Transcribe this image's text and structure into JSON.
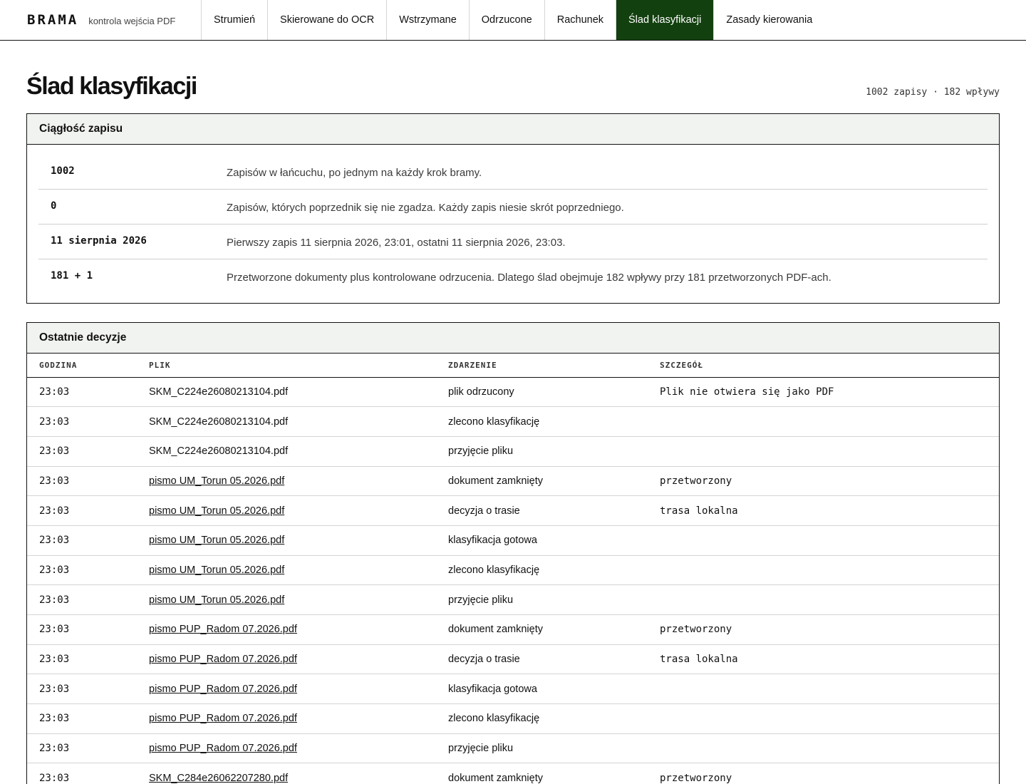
{
  "brand": {
    "logo": "BRAMA",
    "subtitle": "kontrola wejścia PDF"
  },
  "nav": [
    {
      "label": "Strumień",
      "active": false
    },
    {
      "label": "Skierowane do OCR",
      "active": false
    },
    {
      "label": "Wstrzymane",
      "active": false
    },
    {
      "label": "Odrzucone",
      "active": false
    },
    {
      "label": "Rachunek",
      "active": false
    },
    {
      "label": "Ślad klasyfikacji",
      "active": true
    },
    {
      "label": "Zasady kierowania",
      "active": false
    }
  ],
  "page": {
    "title": "Ślad klasyfikacji",
    "meta": "1002 zapisy · 182 wpływy"
  },
  "continuity": {
    "title": "Ciągłość zapisu",
    "rows": [
      {
        "value": "1002",
        "desc": "Zapisów w łańcuchu, po jednym na każdy krok bramy."
      },
      {
        "value": "0",
        "desc": "Zapisów, których poprzednik się nie zgadza. Każdy zapis niesie skrót poprzedniego."
      },
      {
        "value": "11 sierpnia 2026",
        "desc": "Pierwszy zapis 11 sierpnia 2026, 23:01, ostatni 11 sierpnia 2026, 23:03."
      },
      {
        "value": "181 + 1",
        "desc": "Przetworzone dokumenty plus kontrolowane odrzucenia. Dlatego ślad obejmuje 182 wpływy przy 181 przetworzonych PDF-ach."
      }
    ]
  },
  "decisions": {
    "title": "Ostatnie decyzje",
    "columns": [
      "GODZINA",
      "PLIK",
      "ZDARZENIE",
      "SZCZEGÓŁ"
    ],
    "rows": [
      {
        "time": "23:03",
        "file": "SKM_C224e26080213104.pdf",
        "file_link": false,
        "event": "plik odrzucony",
        "detail": "Plik nie otwiera się jako PDF"
      },
      {
        "time": "23:03",
        "file": "SKM_C224e26080213104.pdf",
        "file_link": false,
        "event": "zlecono klasyfikację",
        "detail": ""
      },
      {
        "time": "23:03",
        "file": "SKM_C224e26080213104.pdf",
        "file_link": false,
        "event": "przyjęcie pliku",
        "detail": ""
      },
      {
        "time": "23:03",
        "file": "pismo UM_Torun 05.2026.pdf",
        "file_link": true,
        "event": "dokument zamknięty",
        "detail": "przetworzony"
      },
      {
        "time": "23:03",
        "file": "pismo UM_Torun 05.2026.pdf",
        "file_link": true,
        "event": "decyzja o trasie",
        "detail": "trasa lokalna"
      },
      {
        "time": "23:03",
        "file": "pismo UM_Torun 05.2026.pdf",
        "file_link": true,
        "event": "klasyfikacja gotowa",
        "detail": ""
      },
      {
        "time": "23:03",
        "file": "pismo UM_Torun 05.2026.pdf",
        "file_link": true,
        "event": "zlecono klasyfikację",
        "detail": ""
      },
      {
        "time": "23:03",
        "file": "pismo UM_Torun 05.2026.pdf",
        "file_link": true,
        "event": "przyjęcie pliku",
        "detail": ""
      },
      {
        "time": "23:03",
        "file": "pismo PUP_Radom 07.2026.pdf",
        "file_link": true,
        "event": "dokument zamknięty",
        "detail": "przetworzony"
      },
      {
        "time": "23:03",
        "file": "pismo PUP_Radom 07.2026.pdf",
        "file_link": true,
        "event": "decyzja o trasie",
        "detail": "trasa lokalna"
      },
      {
        "time": "23:03",
        "file": "pismo PUP_Radom 07.2026.pdf",
        "file_link": true,
        "event": "klasyfikacja gotowa",
        "detail": ""
      },
      {
        "time": "23:03",
        "file": "pismo PUP_Radom 07.2026.pdf",
        "file_link": true,
        "event": "zlecono klasyfikację",
        "detail": ""
      },
      {
        "time": "23:03",
        "file": "pismo PUP_Radom 07.2026.pdf",
        "file_link": true,
        "event": "przyjęcie pliku",
        "detail": ""
      },
      {
        "time": "23:03",
        "file": "SKM_C284e26062207280.pdf",
        "file_link": true,
        "event": "dokument zamknięty",
        "detail": "przetworzony"
      }
    ]
  }
}
